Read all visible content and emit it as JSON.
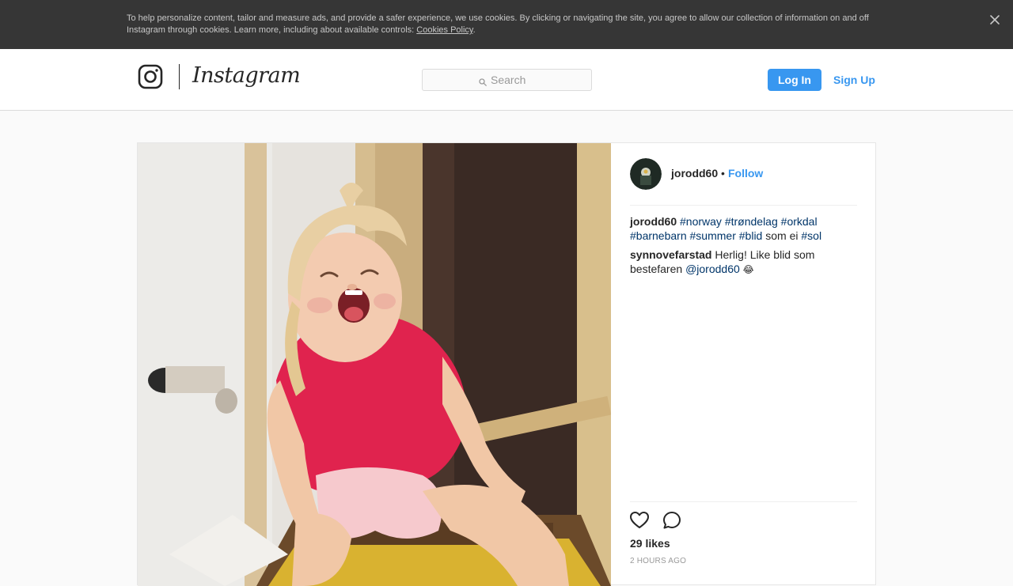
{
  "cookie_banner": {
    "text": "To help personalize content, tailor and measure ads, and provide a safer experience, we use cookies. By clicking or navigating the site, you agree to allow our collection of information on and off Instagram through cookies. Learn more, including about available controls: ",
    "link_label": "Cookies Policy",
    "link_suffix": ".",
    "close_icon": "close-icon"
  },
  "header": {
    "logo_icon": "instagram-glyph-icon",
    "logo_text": "Instagram",
    "search": {
      "placeholder": "Search",
      "value": "",
      "icon": "search-icon"
    },
    "login_label": "Log In",
    "signup_label": "Sign Up"
  },
  "post": {
    "author": "jorodd60",
    "separator": "•",
    "follow_label": "Follow",
    "caption": {
      "user": "jorodd60",
      "hashtags": [
        "#norway",
        "#trøndelag",
        "#orkdal",
        "#barnebarn",
        "#summer",
        "#blid"
      ],
      "text_before_last": "som ei",
      "last_hashtag": "#sol"
    },
    "comment": {
      "user": "synnovefarstad",
      "text": "Herlig! Like blid som bestefaren",
      "mention": "@jorodd60",
      "emoji": "😂"
    },
    "likes": "29 likes",
    "time": "2 HOURS AGO",
    "icons": {
      "like": "heart-icon",
      "comment": "comment-icon"
    }
  },
  "colors": {
    "accent": "#3897f0",
    "hashtag": "#003569",
    "banner_bg": "#363636",
    "page_bg": "#fafafa"
  }
}
